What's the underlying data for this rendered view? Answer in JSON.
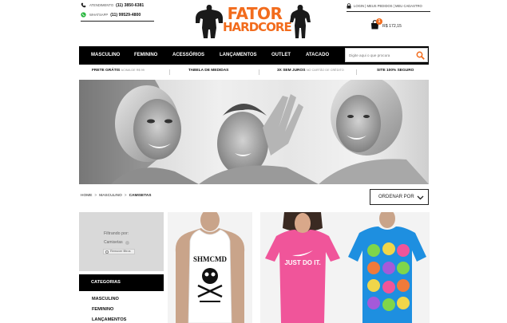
{
  "brand": {
    "logo_line1": "FATOR",
    "logo_line2": "HARDCORE",
    "accent": "#f26c1d"
  },
  "contacts": [
    {
      "icon": "phone-icon",
      "label": "ATENDIMENTO",
      "number": "(11) 3850-6381"
    },
    {
      "icon": "whatsapp-icon",
      "label": "WHATSAPP",
      "number": "(11) 99529-4800"
    }
  ],
  "account": {
    "links": [
      "LOGIN",
      "MEUS PEDIDOS",
      "MEU CADASTRO"
    ]
  },
  "cart": {
    "count": "1",
    "total": "R$ 172,15"
  },
  "nav": {
    "items": [
      "MASCULINO",
      "FEMININO",
      "ACESSÓRIOS",
      "LANÇAMENTOS",
      "OUTLET",
      "ATACADO"
    ]
  },
  "search": {
    "placeholder": "Digite aqui o que procura"
  },
  "info_bar": [
    {
      "strong": "FRETE GRÁTIS",
      "muted": "ACIMA DE R$ 99"
    },
    {
      "strong": "TABELA DE MEDIDAS",
      "muted": ""
    },
    {
      "strong": "3X SEM JUROS",
      "muted": "NO CARTÃO DE CRÉDITO"
    },
    {
      "strong": "SITE 100% SEGURO",
      "muted": ""
    }
  ],
  "breadcrumb": {
    "items": [
      "HOME",
      "MASCULINO"
    ],
    "current": "CAMISETAS"
  },
  "sort": {
    "label": "ORDENAR POR"
  },
  "filters": {
    "title": "Filtrando por:",
    "active": "Camisetas",
    "clear": "Remover filtros"
  },
  "categories": {
    "title": "CATEGORIAS",
    "items": [
      "MASCULINO",
      "FEMININO",
      "LANÇAMENTOS"
    ]
  },
  "products": [
    {
      "name": "tank-top-skull",
      "shirt_color": "#ffffff",
      "print": "SHMCMD"
    },
    {
      "name": "pink-tee-just-do-it",
      "shirt_color": "#f0559a",
      "print": "JUST DO IT."
    },
    {
      "name": "blue-tee-skulls",
      "shirt_color": "#1e8fe0",
      "print": ""
    }
  ]
}
